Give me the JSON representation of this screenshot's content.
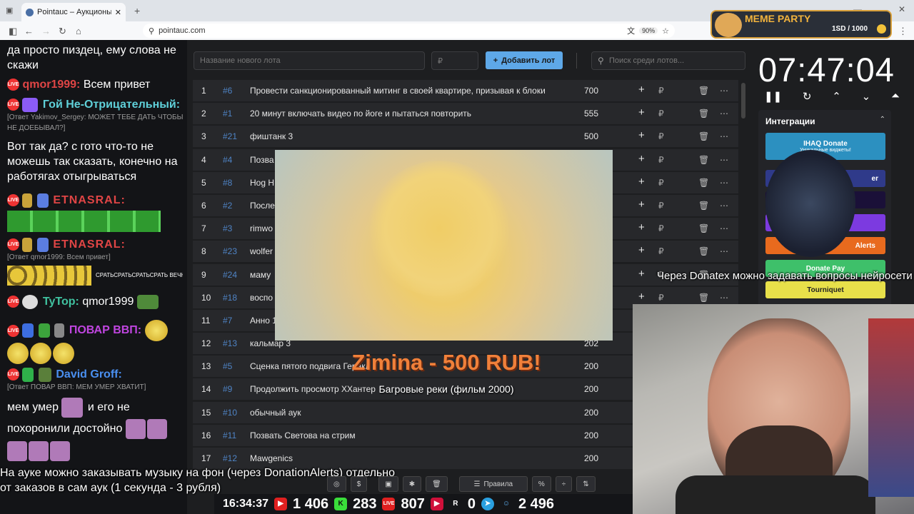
{
  "browser": {
    "tab_title": "Pointauc – Аукционы, лотерея",
    "url": "pointauc.com",
    "zoom": "90%"
  },
  "chat": {
    "m1": "да просто пиздец, ему слова не скажи",
    "m2_user": "qmor1999:",
    "m2_text": "Всем привет",
    "m3_user": "Гой Не-Отрицательный:",
    "m3_reply": "[Ответ Yakimov_Sergey: МОЖЕТ ТЕБЕ ДАТЬ ЧТОБЫ НЕ ДОЕБЫВАЛ?]",
    "m3_text": "Вот так да? с гото что-то не можешь так сказать, конечно на работягах отыгрываться",
    "m4_user": "ETNASRAL:",
    "m5_user": "ETNASRAL:",
    "m5_reply": "[Ответ qmor1999: Всем привет]",
    "m5_text": "СРАТЬСРАТЬСРАТЬСРАТЬ ВЕЧНОВЕЧНОВЕЧНОВЕЧНО",
    "m6_user": "TyTop:",
    "m6_text": "qmor1999",
    "m7_user": "ПОВАР ВВП:",
    "m8_user": "David Groff:",
    "m8_reply": "[Ответ ПОВАР ВВП: МЕМ УМЕР ХВАТИТ]",
    "m8_text1": "мем умер",
    "m8_text2": "и его не похоронили достойно"
  },
  "auction": {
    "new_lot_placeholder": "Название нового лота",
    "amount_placeholder": "₽",
    "add_button": "Добавить лот",
    "search_placeholder": "Поиск среди лотов...",
    "rows": [
      {
        "n": "1",
        "id": "#6",
        "title": "Провести санкционированный митинг в своей квартире, призывая к блоки",
        "value": "700"
      },
      {
        "n": "2",
        "id": "#1",
        "title": "20 минут включать видео по йоге и пытаться повторить",
        "value": "555"
      },
      {
        "n": "3",
        "id": "#21",
        "title": "фиштанк 3",
        "value": "500"
      },
      {
        "n": "4",
        "id": "#4",
        "title": "Позва",
        "value": ""
      },
      {
        "n": "5",
        "id": "#8",
        "title": "Hog H",
        "value": ""
      },
      {
        "n": "6",
        "id": "#2",
        "title": "После",
        "value": ""
      },
      {
        "n": "7",
        "id": "#3",
        "title": "rimwo",
        "value": ""
      },
      {
        "n": "8",
        "id": "#23",
        "title": "wolfer",
        "value": ""
      },
      {
        "n": "9",
        "id": "#24",
        "title": "маму",
        "value": ""
      },
      {
        "n": "10",
        "id": "#18",
        "title": "воспо",
        "value": ""
      },
      {
        "n": "11",
        "id": "#7",
        "title": "Анно 1",
        "value": ""
      },
      {
        "n": "12",
        "id": "#13",
        "title": "кальмар 3",
        "value": "202"
      },
      {
        "n": "13",
        "id": "#5",
        "title": "Сценка пятого подвига Геракл",
        "value": "200"
      },
      {
        "n": "14",
        "id": "#9",
        "title": "Продолжить просмотр ХХантер",
        "value": "200"
      },
      {
        "n": "15",
        "id": "#10",
        "title": "обычный аук",
        "value": "200"
      },
      {
        "n": "16",
        "id": "#11",
        "title": "Позвать Светова на стрим",
        "value": "200"
      },
      {
        "n": "17",
        "id": "#12",
        "title": "Mawgenics",
        "value": "200"
      }
    ],
    "toolbar": {
      "rules": "Правила",
      "percent": "%"
    }
  },
  "right": {
    "timer": "07:47:04",
    "integrations_title": "Интеграции",
    "ihaq": "IHAQ Donate",
    "ihaq_sub": "Уникальные виджеты!",
    "alerts": "Alerts",
    "donatepay": "Donate Pay",
    "tourniquet": "Tourniquet",
    "er": "er"
  },
  "overlay": {
    "meme_title": "MEME PARTY",
    "meme_count": "1SD / 1000",
    "donation": "Zimina - 500 RUB!",
    "song": "Багровые реки (фильм 2000)",
    "donatex": "Через Donatex можно задавать вопросы нейросети",
    "bottom_text": "На ауке можно заказывать музыку на фон (через DonationAlerts) отдельно от заказов в сам аук (1 секунда - 3 рубля)"
  },
  "stats": {
    "time": "16:34:37",
    "youtube": "1 406",
    "kick": "283",
    "vk": "807",
    "rutube": "0",
    "telegram": "",
    "viewers": "2 496"
  },
  "colors": {
    "accent": "#5ea8e8",
    "donation": "#f0803a",
    "lot_id": "#4f84c6"
  }
}
